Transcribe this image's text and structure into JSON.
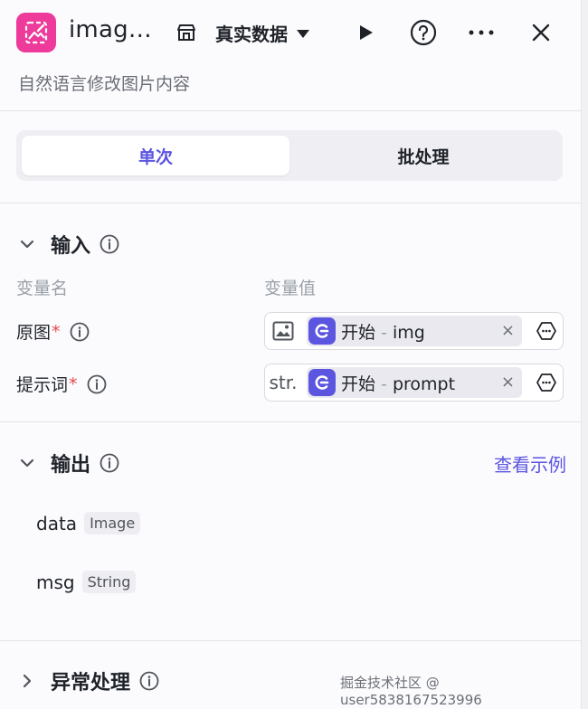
{
  "header": {
    "title": "imag…",
    "subtitle": "自然语言修改图片内容",
    "data_source": "真实数据"
  },
  "mode_tabs": [
    {
      "label": "单次",
      "active": true
    },
    {
      "label": "批处理",
      "active": false
    }
  ],
  "input_section": {
    "title": "输入",
    "col_name": "变量名",
    "col_value": "变量值",
    "rows": [
      {
        "name": "原图",
        "required": "*",
        "type_icon": "image-icon",
        "source": "开始",
        "sep": " - ",
        "ref": "img",
        "remove": "×"
      },
      {
        "name": "提示词",
        "required": "*",
        "type_label": "str.",
        "source": "开始",
        "sep": " - ",
        "ref": "prompt",
        "remove": "×"
      }
    ]
  },
  "output_section": {
    "title": "输出",
    "link": "查看示例",
    "fields": [
      {
        "name": "data",
        "type": "Image"
      },
      {
        "name": "msg",
        "type": "String"
      }
    ]
  },
  "exception_section": {
    "title": "异常处理"
  },
  "watermark": "掘金技术社区 @ user5838167523996",
  "colors": {
    "accent": "#5b55e0",
    "app_icon": "#ee3a9a",
    "required": "#e5484d"
  }
}
